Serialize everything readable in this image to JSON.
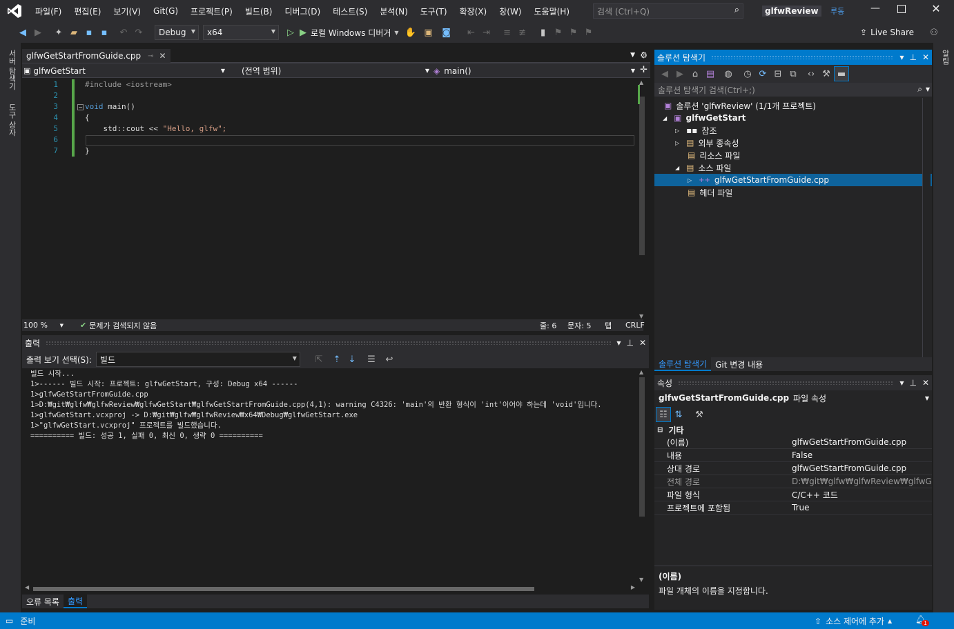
{
  "title_bar": {
    "menus": [
      "파일(F)",
      "편집(E)",
      "보기(V)",
      "Git(G)",
      "프로젝트(P)",
      "빌드(B)",
      "디버그(D)",
      "테스트(S)",
      "분석(N)",
      "도구(T)",
      "확장(X)",
      "창(W)",
      "도움말(H)"
    ],
    "search_placeholder": "검색 (Ctrl+Q)",
    "solution_name": "glfwReview",
    "user_initials": "루동"
  },
  "toolbar": {
    "config": "Debug",
    "platform": "x64",
    "debugger": "로컬 Windows 디버거",
    "live_share": "Live Share"
  },
  "left_strip": {
    "tab1": "서버 탐색기",
    "tab2": "도구 상자"
  },
  "right_strip": {
    "tab1": "알림"
  },
  "editor": {
    "tab_name": "glfwGetStartFromGuide.cpp",
    "nav_project": "glfwGetStart",
    "nav_scope": "(전역 범위)",
    "nav_member": "main()",
    "line_numbers": [
      "1",
      "2",
      "3",
      "4",
      "5",
      "6",
      "7"
    ],
    "code_lines": [
      "#include <iostream>",
      "",
      "void main()",
      "{",
      "    std::cout << \"Hello, glfw\";",
      "",
      "}"
    ],
    "zoom": "100 %",
    "issues": "문제가 검색되지 않음",
    "line_label": "줄: 6",
    "col_label": "문자: 5",
    "tab_label": "탭",
    "eol": "CRLF"
  },
  "output": {
    "title": "출력",
    "source_label": "출력 보기 선택(S):",
    "source_value": "빌드",
    "lines": [
      "빌드 시작...",
      "1>------ 빌드 시작: 프로젝트: glfwGetStart, 구성: Debug x64 ------",
      "1>glfwGetStartFromGuide.cpp",
      "1>D:₩git₩glfw₩glfwReview₩glfwGetStart₩glfwGetStartFromGuide.cpp(4,1): warning C4326: 'main'의 반환 형식이 'int'이어야 하는데 'void'입니다.",
      "1>glfwGetStart.vcxproj -> D:₩git₩glfw₩glfwReview₩x64₩Debug₩glfwGetStart.exe",
      "1>\"glfwGetStart.vcxproj\" 프로젝트를 빌드했습니다.",
      "========== 빌드: 성공 1, 실패 0, 최신 0, 생략 0 =========="
    ],
    "bottom_tabs": [
      "오류 목록",
      "출력"
    ]
  },
  "solution_explorer": {
    "title": "솔루션 탐색기",
    "search_placeholder": "솔루션 탐색기 검색(Ctrl+;)",
    "solution": "솔루션 'glfwReview' (1/1개 프로젝트)",
    "project": "glfwGetStart",
    "items": [
      "참조",
      "외부 종속성",
      "리소스 파일",
      "소스 파일",
      "glfwGetStartFromGuide.cpp",
      "헤더 파일"
    ],
    "bottom_tabs": [
      "솔루션 탐색기",
      "Git 변경 내용"
    ]
  },
  "properties": {
    "title": "속성",
    "object_name": "glfwGetStartFromGuide.cpp",
    "object_type": "파일 속성",
    "category": "기타",
    "rows": [
      {
        "key": "(이름)",
        "value": "glfwGetStartFromGuide.cpp"
      },
      {
        "key": "내용",
        "value": "False"
      },
      {
        "key": "상대 경로",
        "value": "glfwGetStartFromGuide.cpp"
      },
      {
        "key": "전체 경로",
        "value": "D:₩git₩glfw₩glfwReview₩glfwGetSta"
      },
      {
        "key": "파일 형식",
        "value": "C/C++ 코드"
      },
      {
        "key": "프로젝트에 포함됨",
        "value": "True"
      }
    ],
    "desc_title": "(이름)",
    "desc_text": "파일 개체의 이름을 지정합니다."
  },
  "status_bar": {
    "ready": "준비",
    "source_control": "소스 제어에 추가",
    "notification_count": "1"
  },
  "colors": {
    "accent": "#007acc",
    "logo": "#68217a",
    "selection": "#0e639c"
  }
}
